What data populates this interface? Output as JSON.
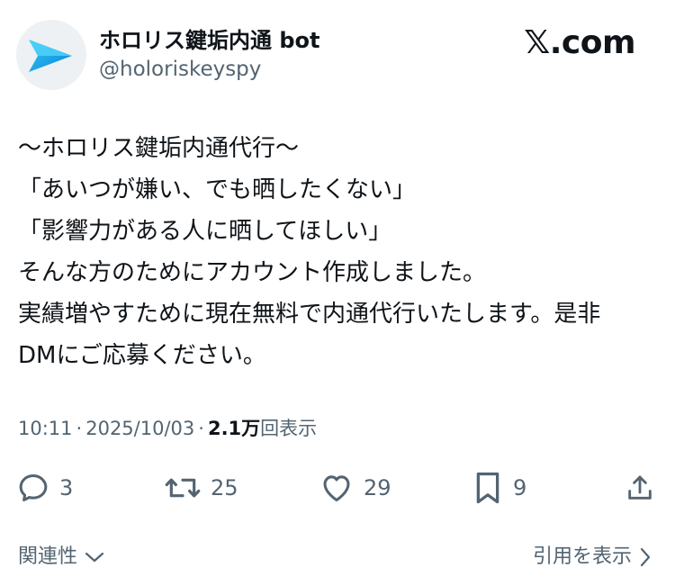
{
  "header": {
    "display_name": "ホロリス鍵垢内通 bot",
    "handle": "@holoriskeyspy",
    "brand": "𝕏.com"
  },
  "tweet": {
    "lines": [
      "〜ホロリス鍵垢内通代行〜",
      "「あいつが嫌い、でも晒したくない」",
      "「影響力がある人に晒してほしい」",
      "そんな方のためにアカウント作成しました。",
      "実績増やすために現在無料で内通代行いたします。是非",
      "DMにご応募ください。"
    ]
  },
  "meta": {
    "time": "10:11",
    "date": "2025/10/03",
    "views_count": "2.1万",
    "views_label": "回表示"
  },
  "actions": {
    "replies": "3",
    "reposts": "25",
    "likes": "29",
    "bookmarks": "9"
  },
  "footer": {
    "related_label": "関連性",
    "quotes_label": "引用を表示"
  },
  "colors": {
    "text": "#0f1419",
    "secondary": "#536471",
    "avatar_blue": "#1da1f2"
  },
  "icons": {
    "reply": "reply-bubble-icon",
    "repost": "repost-icon",
    "like": "heart-icon",
    "bookmark": "bookmark-icon",
    "share": "share-icon"
  }
}
